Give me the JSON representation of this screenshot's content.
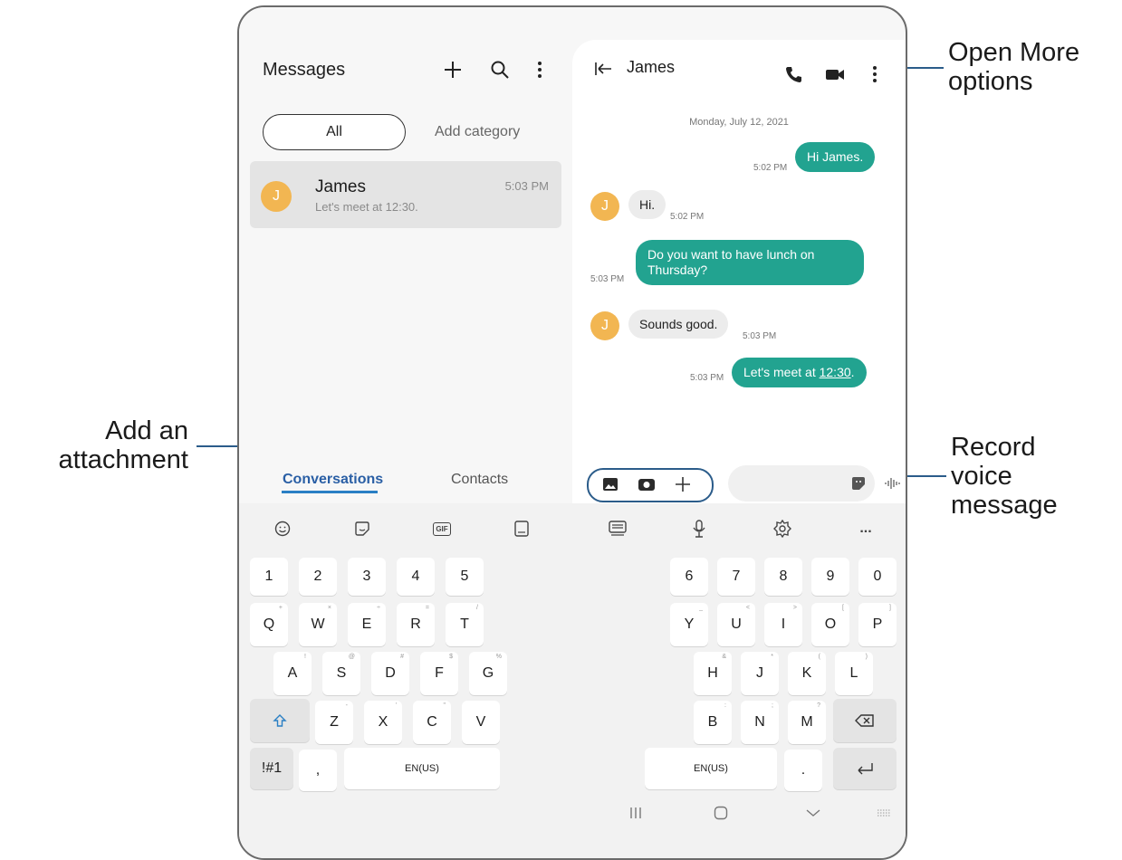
{
  "callouts": {
    "more_options": [
      "Open More",
      "options"
    ],
    "add_attachment": [
      "Add an",
      "attachment"
    ],
    "record_voice": [
      "Record",
      "voice",
      "message"
    ]
  },
  "list_pane": {
    "title": "Messages",
    "filter_all": "All",
    "add_category": "Add category",
    "conversation": {
      "avatar_letter": "J",
      "name": "James",
      "preview": "Let's meet at 12:30.",
      "time": "5:03 PM"
    },
    "tabs": [
      "Conversations",
      "Contacts"
    ]
  },
  "chat": {
    "name": "James",
    "date": "Monday, July 12, 2021",
    "avatar_letter": "J",
    "messages": [
      {
        "dir": "out",
        "text": "Hi James.",
        "time": "5:02 PM"
      },
      {
        "dir": "in",
        "text": "Hi.",
        "time": "5:02 PM"
      },
      {
        "dir": "out",
        "text": "Do you want to have lunch on Thursday?",
        "time": "5:03 PM"
      },
      {
        "dir": "in",
        "text": "Sounds good.",
        "time": "5:03 PM"
      },
      {
        "dir": "out",
        "text": "Let's meet at ",
        "link": "12:30",
        "suffix": ".",
        "time": "5:03 PM"
      }
    ]
  },
  "keyboard": {
    "toolbar_icons": [
      "emoji-icon",
      "sticker-icon",
      "gif-icon",
      "keyboard-split-icon",
      "keyboard-icon",
      "microphone-icon",
      "settings-icon",
      "more-icon"
    ],
    "gif_label": "GIF",
    "more_label": "...",
    "left": {
      "numbers": [
        "1",
        "2",
        "3",
        "4",
        "5"
      ],
      "row1": [
        [
          "Q",
          "+"
        ],
        [
          "W",
          "×"
        ],
        [
          "E",
          "÷"
        ],
        [
          "R",
          "="
        ],
        [
          "T",
          "/"
        ]
      ],
      "row2": [
        [
          "A",
          "!"
        ],
        [
          "S",
          "@"
        ],
        [
          "D",
          "#"
        ],
        [
          "F",
          "$"
        ],
        [
          "G",
          "%"
        ]
      ],
      "row3": [
        [
          "Z",
          "-"
        ],
        [
          "X",
          "'"
        ],
        [
          "C",
          "\""
        ],
        [
          "V",
          ""
        ]
      ],
      "sym": "!#1",
      "comma": ",",
      "space": "EN(US)"
    },
    "right": {
      "numbers": [
        "6",
        "7",
        "8",
        "9",
        "0"
      ],
      "row1": [
        [
          "Y",
          "_"
        ],
        [
          "U",
          "<"
        ],
        [
          "I",
          ">"
        ],
        [
          "O",
          "["
        ],
        [
          "P",
          "]"
        ]
      ],
      "row2": [
        [
          "H",
          "&"
        ],
        [
          "J",
          "*"
        ],
        [
          "K",
          "("
        ],
        [
          "L",
          ")"
        ]
      ],
      "row3": [
        [
          "B",
          ":"
        ],
        [
          "N",
          ";"
        ],
        [
          "M",
          "?"
        ]
      ],
      "space": "EN(US)",
      "period": "."
    }
  },
  "colors": {
    "accent": "#22a390",
    "avatar": "#f2b652",
    "tab_active": "#2a5fa5",
    "callout_line": "#2b5c8a"
  }
}
